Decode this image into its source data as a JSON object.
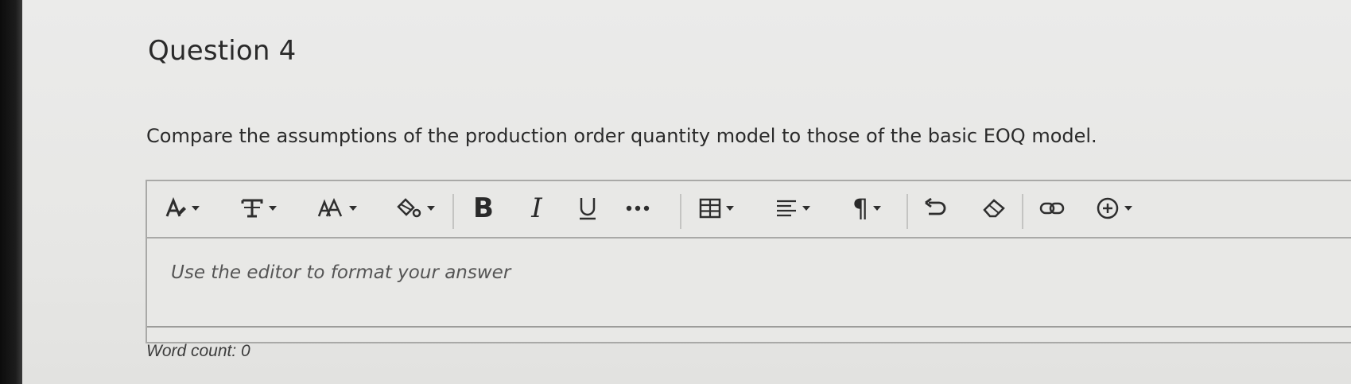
{
  "question": {
    "title": "Question 4",
    "prompt": "Compare the assumptions of the production order quantity model to those of the basic EOQ model."
  },
  "editor": {
    "toolbar": {
      "tools": [
        {
          "name": "font-style-icon",
          "dropdown": true
        },
        {
          "name": "text-format-icon",
          "dropdown": true
        },
        {
          "name": "font-size-icon",
          "dropdown": true
        },
        {
          "name": "highlight-icon",
          "dropdown": true
        },
        {
          "name": "bold-icon",
          "glyph": "B"
        },
        {
          "name": "italic-icon",
          "glyph": "I"
        },
        {
          "name": "underline-icon",
          "glyph": "U"
        },
        {
          "name": "more-icon",
          "glyph": "•••"
        },
        {
          "name": "table-icon",
          "dropdown": true
        },
        {
          "name": "align-icon",
          "dropdown": true
        },
        {
          "name": "paragraph-icon",
          "glyph": "¶",
          "dropdown": true
        },
        {
          "name": "undo-icon"
        },
        {
          "name": "eraser-icon"
        },
        {
          "name": "link-icon"
        },
        {
          "name": "insert-icon",
          "dropdown": true
        }
      ]
    },
    "placeholder": "Use the editor to format your answer",
    "value": ""
  },
  "word_count": {
    "label": "Word count: 0"
  }
}
